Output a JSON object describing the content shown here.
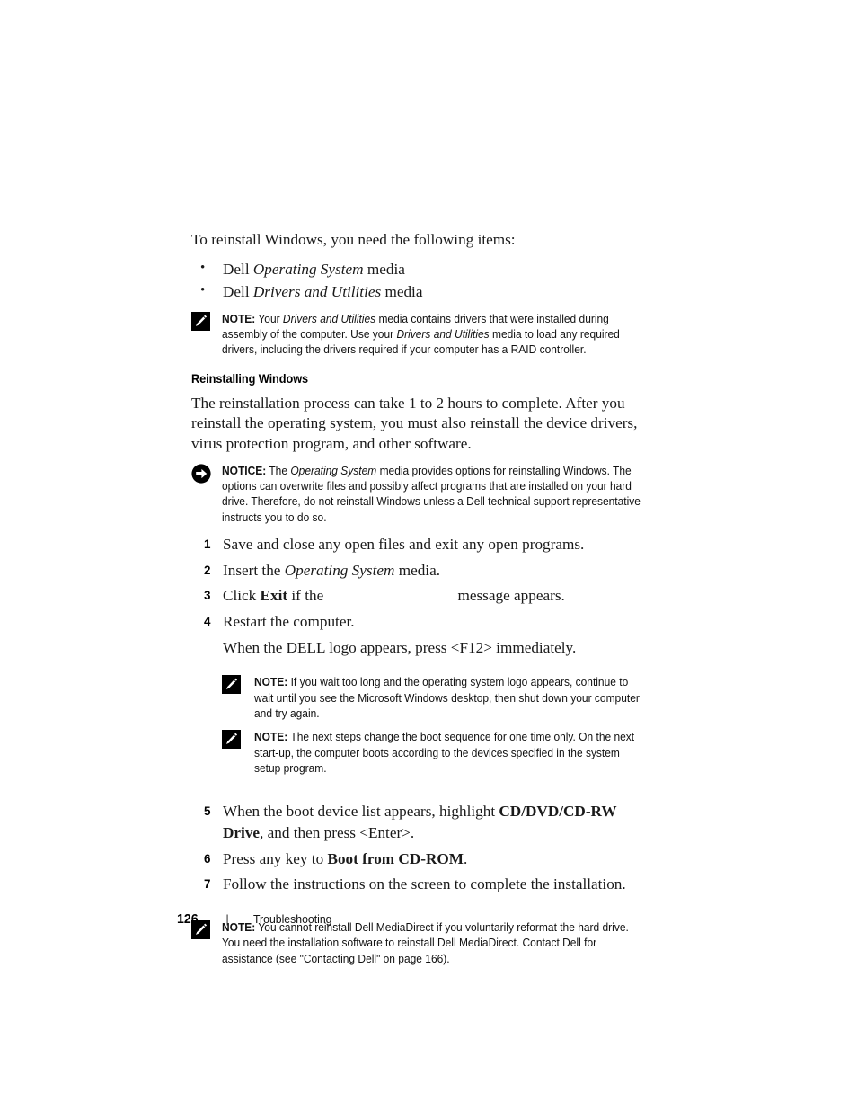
{
  "document": {
    "intro": "To reinstall Windows, you need the following items:",
    "bullets": [
      {
        "prefix": "Dell ",
        "italic": "Operating System",
        "suffix": " media"
      },
      {
        "prefix": "Dell ",
        "italic": "Drivers and Utilities",
        "suffix": " media"
      }
    ],
    "note_media": {
      "label": "NOTE:",
      "icon": "note-pencil-icon",
      "text_parts": [
        {
          "type": "text",
          "value": " Your "
        },
        {
          "type": "italic",
          "value": "Drivers and Utilities"
        },
        {
          "type": "text",
          "value": " media contains drivers that were installed during assembly of the computer. Use your "
        },
        {
          "type": "italic",
          "value": "Drivers and Utilities"
        },
        {
          "type": "text",
          "value": " media to load any required drivers, including the drivers required if your computer has a RAID controller."
        }
      ]
    },
    "section_heading": "Reinstalling Windows",
    "section_intro": "The reinstallation process can take 1 to 2 hours to complete. After you reinstall the operating system, you must also reinstall the device drivers, virus protection program, and other software.",
    "notice_reinstall": {
      "label": "NOTICE:",
      "icon": "notice-arrow-icon",
      "text_parts": [
        {
          "type": "text",
          "value": " The "
        },
        {
          "type": "italic",
          "value": "Operating System"
        },
        {
          "type": "text",
          "value": " media provides options for reinstalling Windows. The options can overwrite files and possibly affect programs that are installed on your hard drive. Therefore, do not reinstall Windows unless a Dell technical support representative instructs you to do so."
        }
      ]
    },
    "steps": [
      {
        "number": "1",
        "parts": [
          {
            "type": "text",
            "value": "Save and close any open files and exit any open programs."
          }
        ]
      },
      {
        "number": "2",
        "parts": [
          {
            "type": "text",
            "value": "Insert the "
          },
          {
            "type": "italic",
            "value": "Operating System"
          },
          {
            "type": "text",
            "value": " media."
          }
        ]
      },
      {
        "number": "3",
        "parts": [
          {
            "type": "text",
            "value": "Click "
          },
          {
            "type": "bold",
            "value": "Exit"
          },
          {
            "type": "text",
            "value": " if the "
          },
          {
            "type": "gap",
            "value": ""
          },
          {
            "type": "text",
            "value": "message appears."
          }
        ]
      },
      {
        "number": "4",
        "parts": [
          {
            "type": "text",
            "value": "Restart the computer."
          }
        ]
      },
      {
        "number": "5",
        "parts": [
          {
            "type": "text",
            "value": "When the boot device list appears, highlight "
          },
          {
            "type": "bold",
            "value": "CD/DVD/CD-RW Drive"
          },
          {
            "type": "text",
            "value": ", and then press <Enter>."
          }
        ]
      },
      {
        "number": "6",
        "parts": [
          {
            "type": "text",
            "value": "Press any key to "
          },
          {
            "type": "bold",
            "value": "Boot from CD-ROM"
          },
          {
            "type": "text",
            "value": "."
          }
        ]
      },
      {
        "number": "7",
        "parts": [
          {
            "type": "text",
            "value": "Follow the instructions on the screen to complete the installation."
          }
        ]
      }
    ],
    "substep_f12": "When the DELL logo appears, press <F12> immediately.",
    "note_logo": {
      "label": "NOTE:",
      "icon": "note-pencil-icon",
      "text_parts": [
        {
          "type": "text",
          "value": " If you wait too long and the operating system logo appears, continue to wait until you see the Microsoft Windows desktop, then shut down your computer and try again."
        }
      ]
    },
    "note_boot_sequence": {
      "label": "NOTE:",
      "icon": "note-pencil-icon",
      "text_parts": [
        {
          "type": "text",
          "value": " The next steps change the boot sequence for one time only. On the next start-up, the computer boots according to the devices specified in the system setup program."
        }
      ]
    },
    "note_mediadirect": {
      "label": "NOTE:",
      "icon": "note-pencil-icon",
      "text_parts": [
        {
          "type": "text",
          "value": " You cannot reinstall Dell MediaDirect if you voluntarily reformat the hard drive. You need the installation software to reinstall Dell MediaDirect. Contact Dell for assistance (see \"Contacting Dell\" on page 166)."
        }
      ]
    },
    "footer": {
      "page_number": "126",
      "separator": "|",
      "chapter": "Troubleshooting"
    }
  }
}
